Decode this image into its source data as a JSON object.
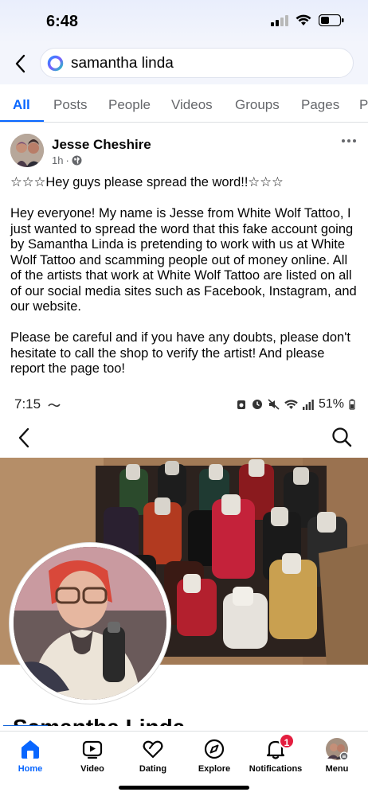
{
  "status_bar": {
    "time": "6:48"
  },
  "search": {
    "query": "samantha linda"
  },
  "tabs": [
    {
      "label": "All",
      "active": true
    },
    {
      "label": "Posts"
    },
    {
      "label": "People"
    },
    {
      "label": "Videos"
    },
    {
      "label": "Groups"
    },
    {
      "label": "Pages"
    },
    {
      "label": "P"
    }
  ],
  "post": {
    "author": "Jesse Cheshire",
    "time": "1h",
    "paragraphs": [
      "☆☆☆Hey guys please spread the word!!☆☆☆",
      "Hey everyone! My name is Jesse from White Wolf Tattoo, I just wanted to spread the word that this fake account going by Samantha Linda is pretending to work with us at White Wolf Tattoo and scamming people out of money online. All of the artists that work at White Wolf Tattoo are listed on all of our social media sites such as Facebook, Instagram, and our website.",
      "Please be careful and if you have any doubts, please don't hesitate to call the shop to verify the artist! And please report the page too!"
    ]
  },
  "embedded_screenshot": {
    "time": "7:15",
    "battery": "51%",
    "profile_name": "Samantha Linda"
  },
  "bottom_nav": {
    "items": [
      {
        "label": "Home",
        "icon": "home-icon",
        "active": true
      },
      {
        "label": "Video",
        "icon": "video-icon"
      },
      {
        "label": "Dating",
        "icon": "dating-heart-icon"
      },
      {
        "label": "Explore",
        "icon": "explore-compass-icon"
      },
      {
        "label": "Notifications",
        "icon": "bell-icon",
        "badge": "1"
      },
      {
        "label": "Menu",
        "icon": "menu-avatar-icon"
      }
    ]
  },
  "colors": {
    "accent": "#0866ff",
    "badge": "#e41e3f",
    "secondary_text": "#65676b"
  }
}
